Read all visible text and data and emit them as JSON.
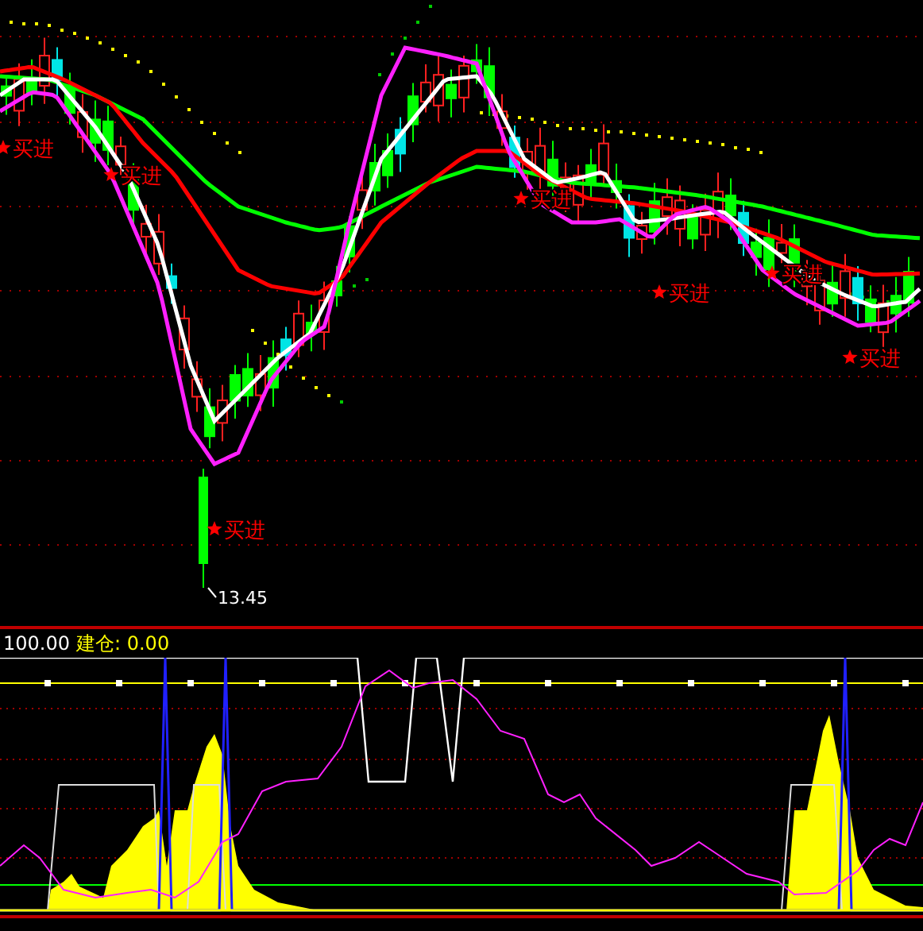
{
  "price_chart": {
    "signals": [
      {
        "label": "买进"
      },
      {
        "label": "买进"
      },
      {
        "label": "买进"
      },
      {
        "label": "买进"
      },
      {
        "label": "买进"
      },
      {
        "label": "买进"
      },
      {
        "label": "买进"
      }
    ],
    "low_price": "13.45"
  },
  "indicator_panel": {
    "value": "100.00",
    "position_text": "建仓: 0.00"
  }
}
